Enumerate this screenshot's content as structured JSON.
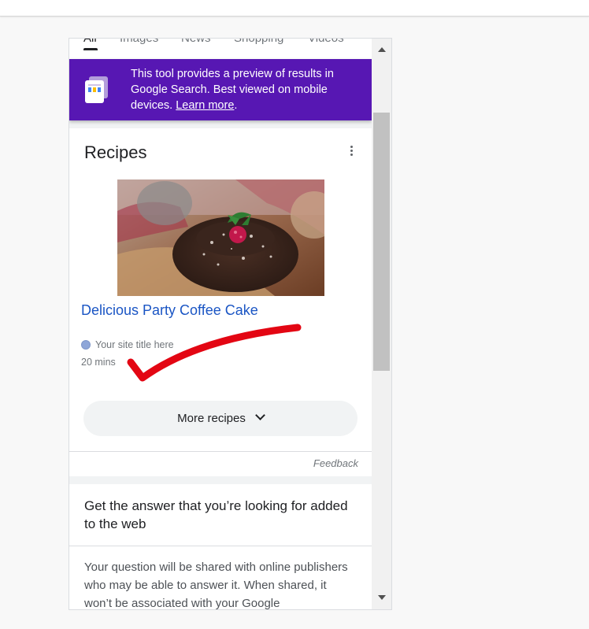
{
  "tabs": [
    "All",
    "Images",
    "News",
    "Shopping",
    "Videos"
  ],
  "banner": {
    "text": "This tool provides a preview of results in Google Search. Best viewed on mobile devices. ",
    "link": "Learn more",
    "suffix": ".",
    "color": "#5717b3"
  },
  "recipes_card": {
    "title": "Recipes",
    "recipe_title": "Delicious Party Coffee Cake",
    "site_title": "Your site title here",
    "time": "20 mins",
    "more_label": "More recipes",
    "feedback": "Feedback"
  },
  "answer_card": {
    "title": "Get the answer that you’re looking for added to the web",
    "body": "Your question will be shared with online publishers who may be able to answer it. When shared, it won’t be associated with your Google"
  },
  "colors": {
    "link": "#1a55c4",
    "annotation": "#e30613"
  }
}
